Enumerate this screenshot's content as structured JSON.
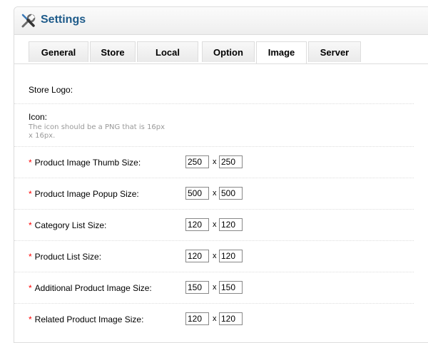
{
  "heading": {
    "title": "Settings"
  },
  "tabs": [
    {
      "label": "General"
    },
    {
      "label": "Store"
    },
    {
      "label": "Local"
    },
    {
      "label": "Option"
    },
    {
      "label": "Image",
      "active": true
    },
    {
      "label": "Server"
    }
  ],
  "form": {
    "store_logo_label": "Store Logo:",
    "icon_label": "Icon:",
    "icon_help": "The icon should be a PNG that is 16px x 16px.",
    "required_mark": "*",
    "separator": "x",
    "size_rows": [
      {
        "label": "Product Image Thumb Size:",
        "width": "250",
        "height": "250"
      },
      {
        "label": "Product Image Popup Size:",
        "width": "500",
        "height": "500"
      },
      {
        "label": "Category List Size:",
        "width": "120",
        "height": "120"
      },
      {
        "label": "Product List Size:",
        "width": "120",
        "height": "120"
      },
      {
        "label": "Additional Product Image Size:",
        "width": "150",
        "height": "150"
      },
      {
        "label": "Related Product Image Size:",
        "width": "120",
        "height": "120"
      }
    ]
  },
  "colors": {
    "title": "#1e5b8a",
    "required": "#ff0000",
    "help_text": "#999999",
    "border": "#dddddd"
  }
}
